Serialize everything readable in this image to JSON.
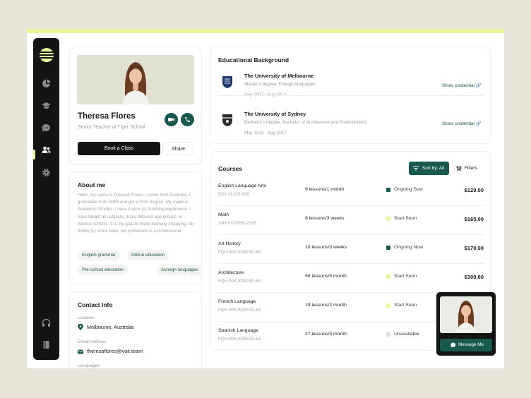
{
  "sidebar": {
    "icons": [
      "logo",
      "chart-icon",
      "graduation-cap-icon",
      "chat-icon",
      "users-icon",
      "gear-icon",
      "headphones-icon",
      "book-icon"
    ],
    "active": "users-icon"
  },
  "profile": {
    "name": "Theresa Flores",
    "role": "Senior Teacher at Tiger School",
    "book_label": "Book a Class",
    "share_label": "Share"
  },
  "about": {
    "title": "About me",
    "text": "Hello, my name is Theresa Flores. I come from Australia. I graduated from DoMi and got a PHD degree. My major is Academic Studies. I have 4 year (s) teaching experience. I have taught all subjects, many different age groups, in various schools. It is my goal to make learning engaging. My hobby (s) is/are bake. My profession is a professional.",
    "tags": [
      "English grammar",
      "Online education",
      "Pre-school education",
      "Aoreign languages"
    ]
  },
  "contact": {
    "title": "Contact Info",
    "location_label": "Location",
    "location": "Melbourne, Australia",
    "email_label": "Email Address",
    "email": "theresaflores@voit.team",
    "languages_label": "Languages"
  },
  "education": {
    "title": "Educational Background",
    "items": [
      {
        "school": "The University of Melbourne",
        "degree": "Master's degree, Foreign languages",
        "dates": "Sep 2007 - Aug 2012",
        "link": "Show credential"
      },
      {
        "school": "The University of Sydney",
        "degree": "Bachelor's degree, Bachelor of Architecture and Environments",
        "dates": "May 2013 - Aug 2017",
        "link": "Show credential"
      }
    ]
  },
  "courses": {
    "title": "Courses",
    "sort_label": "Sort by: All",
    "filter_label": "Filters",
    "rows": [
      {
        "name": "English Language Arts",
        "code": "5GY-11-OS-008",
        "lessons": "9 lessons/1 month",
        "status": "Ongoing Sow",
        "status_color": "#17594f",
        "price": "$129.00"
      },
      {
        "name": "Math",
        "code": "10H-V7-005D-202E",
        "lessons": "8 lessons/3 weeks",
        "status": "Start Soon",
        "status_color": "#eaf799",
        "price": "$165.00"
      },
      {
        "name": "Art History",
        "code": "FQH-90K-K991SD-6A",
        "lessons": "10 lessons/3 weeks",
        "status": "Ongoing Now",
        "status_color": "#17594f",
        "price": "$170.00"
      },
      {
        "name": "Architecture",
        "code": "FQH-90K-K991SD-6A",
        "lessons": "59 lessons/5 month",
        "status": "Start Soon",
        "status_color": "#eaf799",
        "price": "$300.00"
      },
      {
        "name": "French Language",
        "code": "FQH-90K-K991SD-6A",
        "lessons": "19 lessons/2 month",
        "status": "Start Soon",
        "status_color": "#eaf799",
        "price": ""
      },
      {
        "name": "Spanish Language",
        "code": "FQH-90K-K991SD-6A",
        "lessons": "27 lessons/3 month",
        "status": "Unavailable",
        "status_color": "#dcdcd4",
        "price": ""
      }
    ]
  },
  "video": {
    "message_label": "Message Me"
  }
}
